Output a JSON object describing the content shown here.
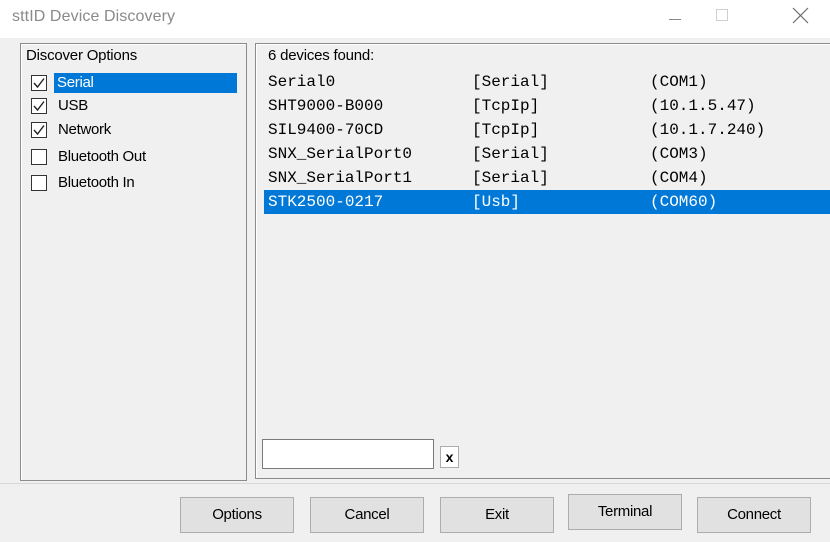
{
  "window": {
    "title": "sttID Device Discovery",
    "controls": [
      "minimize-icon",
      "maximize-icon",
      "close-icon"
    ]
  },
  "discover_options": {
    "title": "Discover Options",
    "items": [
      {
        "label": "Serial",
        "checked": true,
        "selected": true
      },
      {
        "label": "USB",
        "checked": true,
        "selected": false
      },
      {
        "label": "Network",
        "checked": true,
        "selected": false
      },
      {
        "label": "Bluetooth Out",
        "checked": false,
        "selected": false
      },
      {
        "label": "Bluetooth In",
        "checked": false,
        "selected": false
      }
    ]
  },
  "devices": {
    "status": "6 devices found:",
    "rows": [
      {
        "name": "Serial0",
        "type": "[Serial]",
        "port": "(COM1)",
        "selected": false
      },
      {
        "name": "SHT9000-B000",
        "type": "[TcpIp]",
        "port": "(10.1.5.47)",
        "selected": false
      },
      {
        "name": "SIL9400-70CD",
        "type": "[TcpIp]",
        "port": "(10.1.7.240)",
        "selected": false
      },
      {
        "name": "SNX_SerialPort0",
        "type": "[Serial]",
        "port": "(COM3)",
        "selected": false
      },
      {
        "name": "SNX_SerialPort1",
        "type": "[Serial]",
        "port": "(COM4)",
        "selected": false
      },
      {
        "name": "STK2500-0217",
        "type": "[Usb]",
        "port": "(COM60)",
        "selected": true
      }
    ]
  },
  "filter": {
    "value": "",
    "clear_label": "x"
  },
  "buttons": {
    "options": "Options",
    "cancel": "Cancel",
    "exit": "Exit",
    "terminal": "Terminal",
    "connect": "Connect"
  },
  "colors": {
    "selection": "#0078d7",
    "title_text": "#8a8a8a",
    "background": "#f0f0f0"
  }
}
